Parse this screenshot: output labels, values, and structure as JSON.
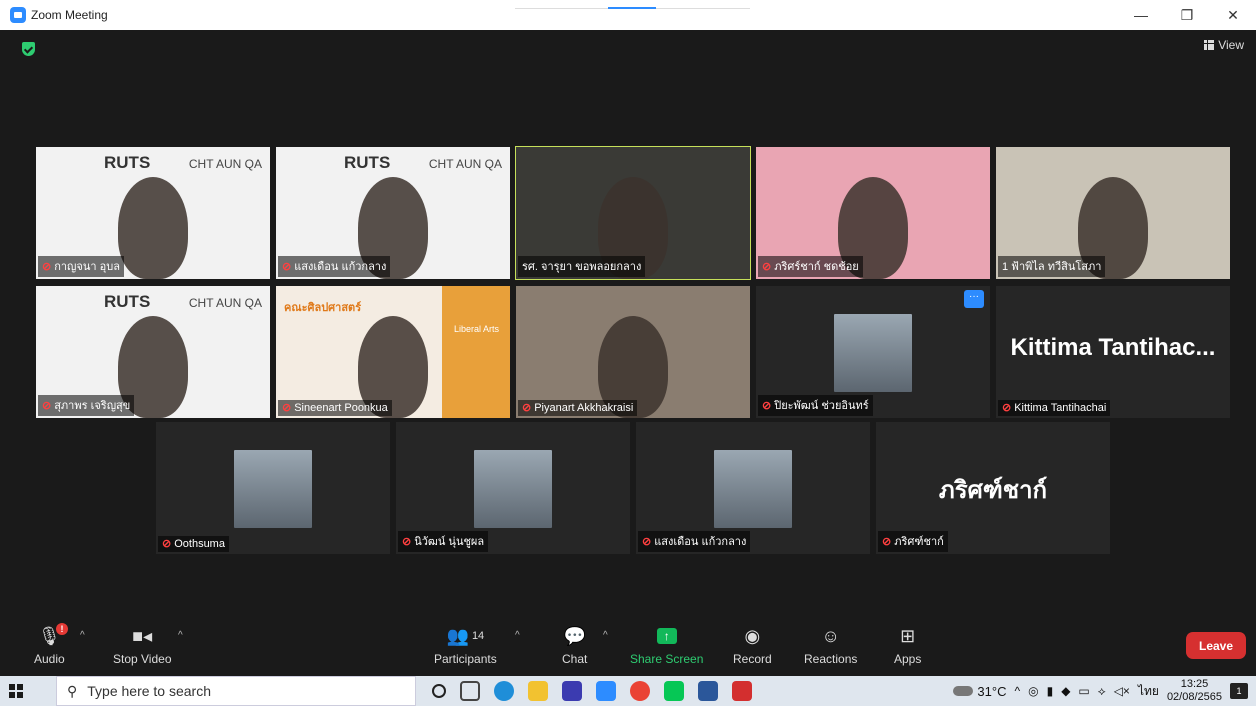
{
  "window": {
    "title": "Zoom Meeting",
    "controls": [
      "—",
      "❐",
      "✕"
    ]
  },
  "top_bar": {
    "view_label": "View"
  },
  "participants_grid": [
    {
      "name": "กาญจนา อุบล",
      "muted": true,
      "kind": "video",
      "bg": "#f2f2f2",
      "brand": "RUTS",
      "banner": "CHT AUN QA"
    },
    {
      "name": "แสงเดือน แก้วกลาง",
      "muted": true,
      "kind": "video",
      "bg": "#f2f2f2",
      "brand": "RUTS",
      "banner": "CHT AUN QA"
    },
    {
      "name": "รศ. จารุยา ขอพลอยกลาง",
      "muted": false,
      "kind": "video",
      "bg": "#3a3a36",
      "active_speaker": true
    },
    {
      "name": "ภริศร์ชาก์ ชดช้อย",
      "muted": true,
      "kind": "video",
      "bg": "#e9a5b3"
    },
    {
      "name": "1 ฟ้าพิไล ทวีสินโสภา",
      "muted": false,
      "kind": "video",
      "bg": "#c9c3b6"
    },
    {
      "name": "สุภาพร เจริญสุข",
      "muted": true,
      "kind": "video",
      "bg": "#f2f2f2",
      "brand": "RUTS",
      "banner": "CHT AUN QA"
    },
    {
      "name": "Sineenart Poonkua",
      "muted": true,
      "kind": "video",
      "bg": "#f4ece2",
      "header": "คณะศิลปศาสตร์",
      "side_label": "Liberal Arts"
    },
    {
      "name": "Piyanart Akkhakraisi",
      "muted": true,
      "kind": "video",
      "bg": "#8a7d70"
    },
    {
      "name": "ปิยะพัฒน์ ช่วยอินทร์",
      "muted": true,
      "kind": "photo",
      "bg": "#262626",
      "more_label": "···"
    },
    {
      "name": "Kittima Tantihachai",
      "muted": true,
      "kind": "name",
      "display_name": "Kittima  Tantihac..."
    },
    {
      "name": "Oothsuma",
      "muted": true,
      "kind": "photo",
      "bg": "#262626"
    },
    {
      "name": "นิวัฒน์ นุ่นชูผล",
      "muted": true,
      "kind": "photo",
      "bg": "#262626"
    },
    {
      "name": "แสงเดือน แก้วกลาง",
      "muted": true,
      "kind": "photo",
      "bg": "#262626"
    },
    {
      "name": "ภริศฑ์ชาก์",
      "muted": true,
      "kind": "name",
      "display_name": "ภริศฑ์ชาก์"
    }
  ],
  "controls": {
    "audio": "Audio",
    "audio_badge": "!",
    "stop_video": "Stop Video",
    "participants": "Participants",
    "participants_count": "14",
    "chat": "Chat",
    "share_screen": "Share Screen",
    "record": "Record",
    "reactions": "Reactions",
    "apps": "Apps",
    "leave": "Leave"
  },
  "taskbar": {
    "search_placeholder": "Type here to search",
    "weather": "31°C",
    "language": "ไทย",
    "time": "13:25",
    "date": "02/08/2565",
    "notification_count": "1"
  },
  "colors": {
    "meeting_bg": "#1a1a1a",
    "tile_bg": "#262626",
    "active_speaker": "#c6e05a",
    "muted_mic": "#ff4040",
    "share_green": "#12b85a",
    "leave_red": "#d63030",
    "zoom_blue": "#2d8cff"
  }
}
